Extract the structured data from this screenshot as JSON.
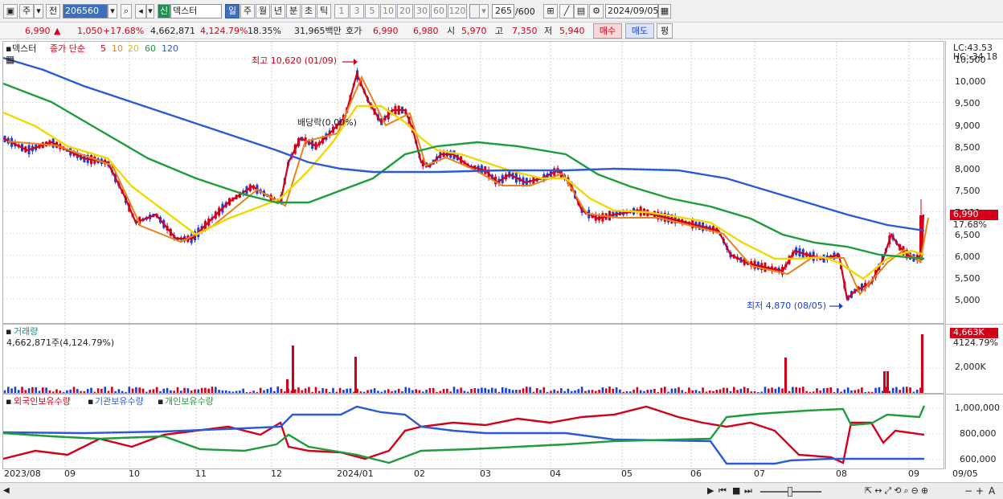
{
  "toolbar": {
    "period_type": "주",
    "prev_label": "전",
    "stock_code": "206560",
    "market_badge": "신",
    "stock_name": "덱스터",
    "periods": [
      "일",
      "주",
      "월",
      "년",
      "분",
      "초",
      "틱"
    ],
    "selected_period": "일",
    "counts": [
      "1",
      "3",
      "5",
      "10",
      "20",
      "30",
      "60",
      "120"
    ],
    "display_count": "265",
    "total_count": "/600",
    "date": "2024/09/05"
  },
  "quote": {
    "price": "6,990",
    "change_arrow": "▲",
    "change": "1,050",
    "change_pct": "+17.68%",
    "volume": "4,662,871",
    "volume_pct": "4,124.79%",
    "turnover": "18.35%",
    "amount": "31,965백만",
    "hoga_label": "호가",
    "ask": "6,990",
    "bid": "6,980",
    "open_label": "시",
    "open": "5,970",
    "high_label": "고",
    "high": "7,350",
    "low_label": "저",
    "low": "5,940",
    "buy_button": "매수",
    "sell_button": "매도",
    "eval_button": "평"
  },
  "price_panel": {
    "legend_name": "덱스터",
    "legend_ma_title": "종가 단순",
    "ma_periods": [
      "5",
      "10",
      "20",
      "60",
      "120"
    ],
    "ma_colors": [
      "#d4001a",
      "#e8821a",
      "#f0d800",
      "#1f9c3c",
      "#2a5ad8"
    ],
    "annotation_high": "최고 10,620 (01/09)",
    "annotation_low": "최저 4,870 (08/05)",
    "annotation_dividend": "배당락(0.00%)",
    "lc": "LC:43.53",
    "hc": "HC:-34.18",
    "last_price_tag": "6,990",
    "last_pct_tag": "17.68%",
    "y_ticks": [
      "10,500",
      "10,000",
      "9,500",
      "9,000",
      "8,500",
      "8,000",
      "7,500",
      "7,000",
      "6,500",
      "6,000",
      "5,500",
      "5,000"
    ]
  },
  "volume_panel": {
    "title": "거래량",
    "value": "4,662,871주(4,124.79%)",
    "tag_value": "4,663K",
    "tag_pct": "4124.79%",
    "y_ticks": [
      "2,000K"
    ]
  },
  "holding_panel": {
    "legend": [
      "외국인보유수량",
      "기관보유수량",
      "개인보유수량"
    ],
    "colors": [
      "#d4001a",
      "#2a5ad8",
      "#1f9c3c"
    ],
    "y_ticks": [
      "1,000,000",
      "800,000",
      "600,000"
    ]
  },
  "x_axis": [
    "2023/08",
    "09",
    "10",
    "11",
    "12",
    "2024/01",
    "02",
    "03",
    "04",
    "05",
    "06",
    "07",
    "08",
    "09",
    "09/05"
  ]
}
